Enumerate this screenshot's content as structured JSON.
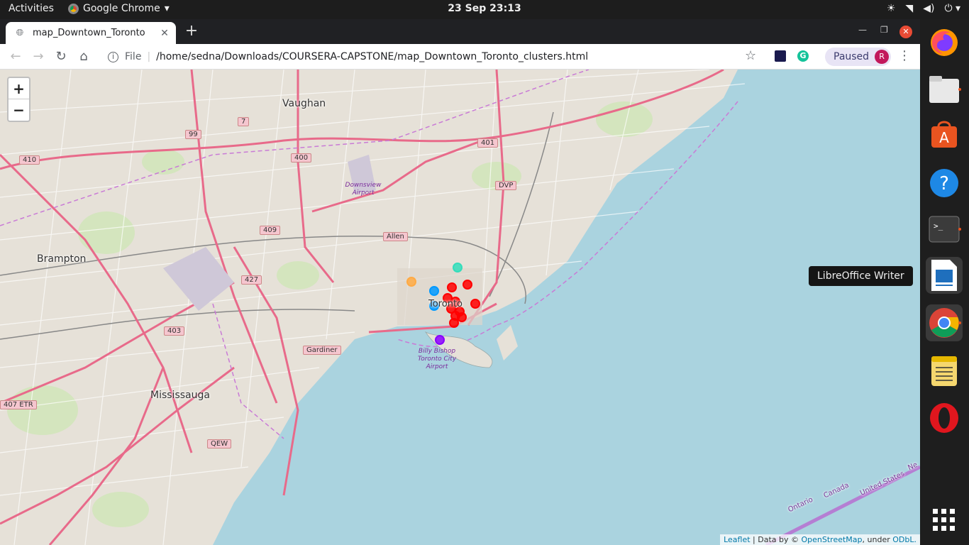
{
  "topbar": {
    "activities": "Activities",
    "app_name": "Google Chrome",
    "clock": "23 Sep  23:13",
    "tray_icons": [
      "brightness-icon",
      "wifi-icon",
      "volume-icon",
      "power-icon"
    ]
  },
  "browser": {
    "tab_title": "map_Downtown_Toronto",
    "file_label": "File",
    "url": "/home/sedna/Downloads/COURSERA-CAPSTONE/map_Downtown_Toronto_clusters.html",
    "profile_status": "Paused",
    "profile_initial": "R",
    "grammarly_initial": "G"
  },
  "map": {
    "zoom_in": "+",
    "zoom_out": "−",
    "places": [
      "Vaughan",
      "Brampton",
      "Mississauga",
      "Toronto"
    ],
    "highways": [
      "Allen",
      "DVP",
      "Gardiner",
      "QEW",
      "407 ETR",
      "401",
      "409",
      "427",
      "400",
      "410",
      "403",
      "99",
      "7"
    ],
    "airports": [
      "Downsview Airport",
      "Billy Bishop Toronto City Airport"
    ],
    "water_labels": [
      "Ontario",
      "Canada",
      "United States",
      "Ne"
    ],
    "attribution": {
      "leaflet": "Leaflet",
      "data_by": " | Data by © ",
      "osm": "OpenStreetMap",
      "under": ", under ",
      "odbl": "ODbL."
    },
    "cluster_colors": {
      "red": "#ff0000",
      "blue": "#0099ff",
      "teal": "#33ddbb",
      "orange": "#ffaa44",
      "purple": "#8800ff"
    }
  },
  "dock": {
    "tooltip": "LibreOffice Writer",
    "apps": [
      "firefox-icon",
      "files-icon",
      "software-icon",
      "help-icon",
      "terminal-icon",
      "writer-icon",
      "chrome-icon",
      "notes-icon",
      "opera-icon",
      "app-grid-icon"
    ]
  }
}
